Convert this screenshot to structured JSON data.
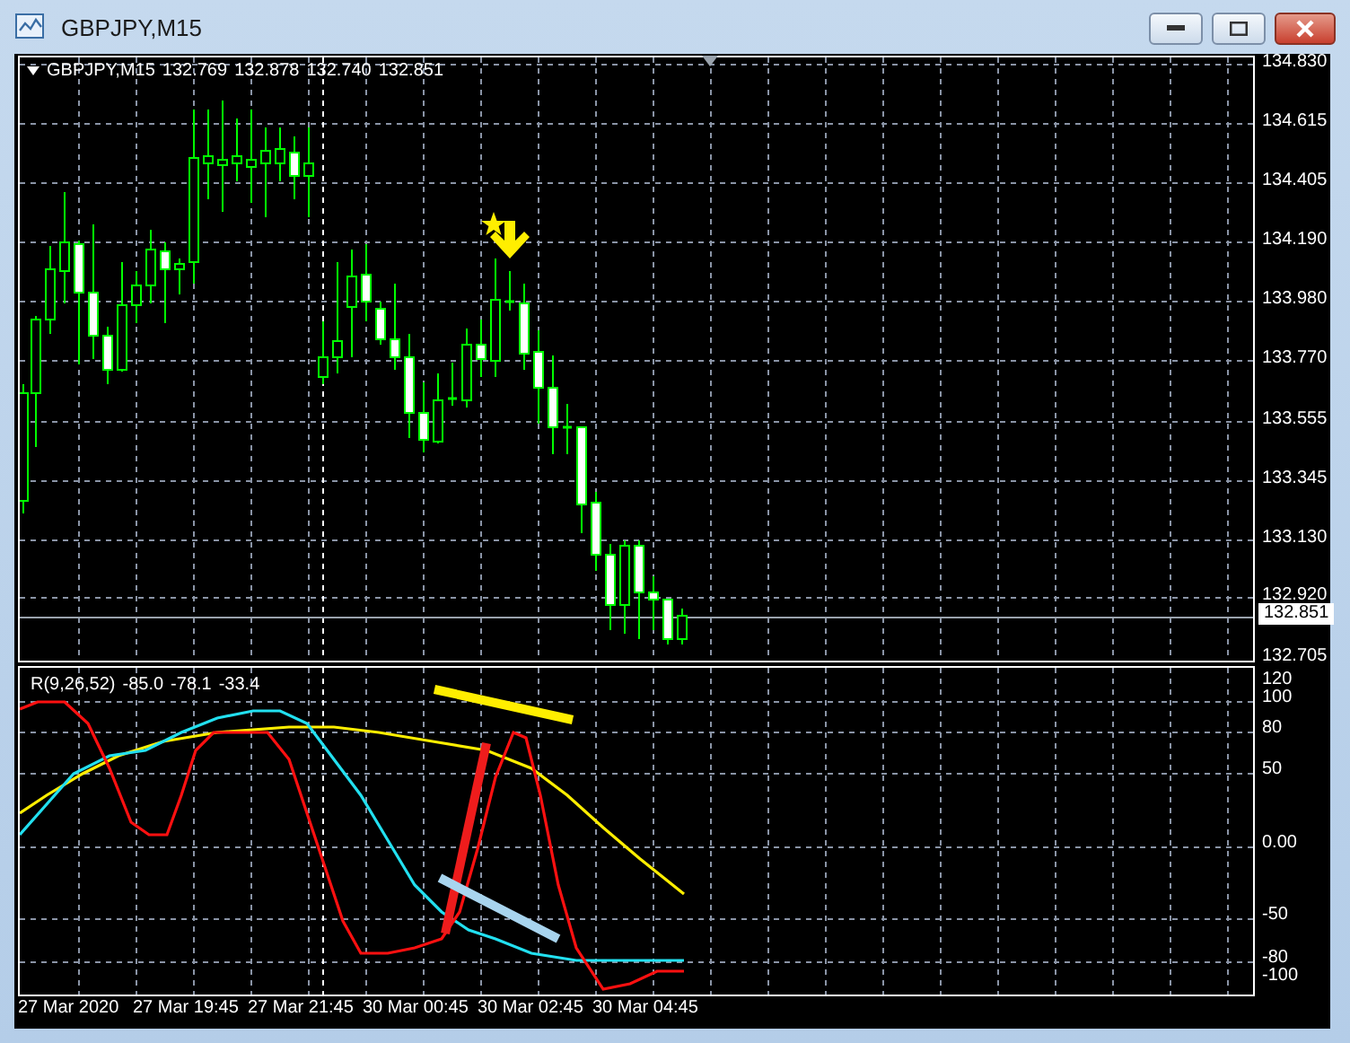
{
  "window": {
    "title": "GBPJPY,M15"
  },
  "chart": {
    "symbol": "GBPJPY,M15",
    "ohlc": [
      "132.769",
      "132.878",
      "132.740",
      "132.851"
    ],
    "price_axis": [
      "134.830",
      "134.615",
      "134.405",
      "134.190",
      "133.980",
      "133.770",
      "133.555",
      "133.345",
      "133.130",
      "132.920",
      "132.705"
    ],
    "current_price": "132.851"
  },
  "indicator": {
    "label": "R(9,26,52)",
    "values": [
      "-85.0",
      "-78.1",
      "-33.4"
    ],
    "axis": [
      "120",
      "100",
      "80",
      "50",
      "0.00",
      "-50",
      "-80",
      "-100"
    ]
  },
  "time_axis": [
    "27 Mar 2020",
    "27 Mar 19:45",
    "27 Mar 21:45",
    "30 Mar 00:45",
    "30 Mar 02:45",
    "30 Mar 04:45"
  ]
}
